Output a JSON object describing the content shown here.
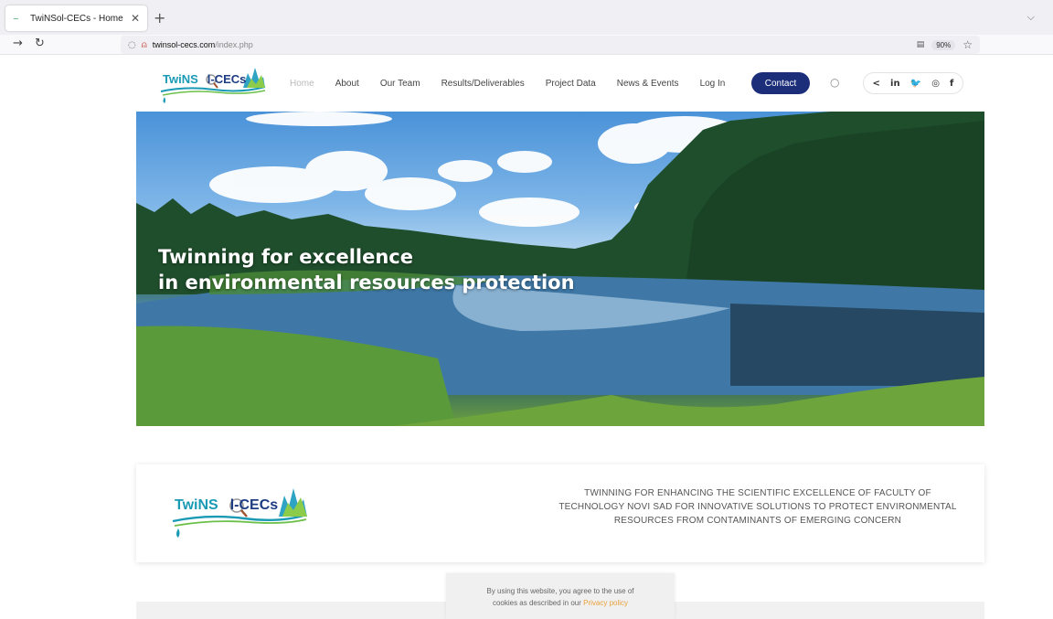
{
  "browser": {
    "tab_title": "TwiNSol-CECs - Home",
    "url_host": "twinsol-cecs.com",
    "url_path": "/index.php",
    "zoom": "90%"
  },
  "logo": {
    "part_a": "TwiNS",
    "part_b": "l-CECs"
  },
  "nav": {
    "items": [
      "Home",
      "About",
      "Our Team",
      "Results/Deliverables",
      "Project Data",
      "News & Events",
      "Log In"
    ],
    "contact_label": "Contact"
  },
  "socials": [
    "in",
    "𝕐",
    "◎",
    "f"
  ],
  "hero": {
    "line1": "Twinning for excellence",
    "line2": "in environmental resources protection"
  },
  "info": {
    "text": "TWINNING FOR ENHANCING THE SCIENTIFIC EXCELLENCE OF FACULTY OF TECHNOLOGY NOVI SAD FOR INNOVATIVE SOLUTIONS TO PROTECT ENVIRONMENTAL RESOURCES FROM CONTAMINANTS OF EMERGING CONCERN"
  },
  "cookie": {
    "line1": "By using this website, you agree to the use of",
    "line2_prefix": "cookies as described in our ",
    "link": "Privacy policy"
  },
  "colors": {
    "contact_button": "#1c2e7a",
    "logo_teal": "#1a9ab5",
    "logo_navy": "#1d3c82",
    "privacy_link": "#e6a23c"
  }
}
